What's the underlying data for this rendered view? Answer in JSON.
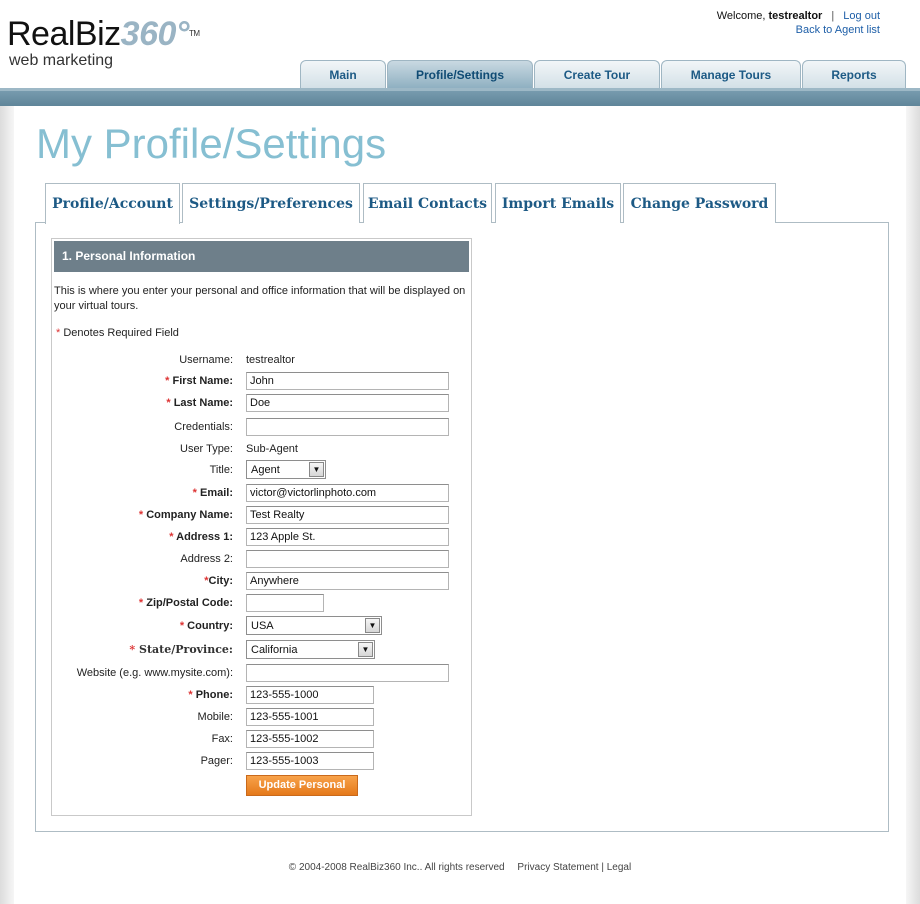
{
  "brand": {
    "name_part1": "RealBiz",
    "name_part2": "360",
    "degree": "°",
    "tm": "TM",
    "tagline": "web marketing"
  },
  "header": {
    "welcome_text": "Welcome,",
    "username": "testrealtor",
    "separator": "|",
    "logout": "Log out",
    "back_link": "Back to Agent list"
  },
  "nav": {
    "tabs": [
      "Main",
      "Profile/Settings",
      "Create Tour",
      "Manage Tours",
      "Reports"
    ],
    "active": "Profile/Settings"
  },
  "page_title": "My Profile/Settings",
  "subtabs": {
    "items": [
      "Profile/Account",
      "Settings/Preferences",
      "Email Contacts",
      "Import Emails",
      "Change Password"
    ],
    "active": "Profile/Account"
  },
  "section": {
    "title": "1. Personal Information",
    "intro": "This is where you enter your personal and office information that will be displayed on your virtual tours.",
    "required_note": "Denotes Required Field",
    "star": "*"
  },
  "form": {
    "username": {
      "label": "Username:",
      "value": "testrealtor"
    },
    "first_name": {
      "label": "First Name:",
      "value": "John"
    },
    "last_name": {
      "label": "Last Name:",
      "value": "Doe"
    },
    "credentials": {
      "label": "Credentials:",
      "value": ""
    },
    "user_type": {
      "label": "User Type:",
      "value": "Sub-Agent"
    },
    "title": {
      "label": "Title:",
      "value": "Agent"
    },
    "email": {
      "label": "Email:",
      "value": "victor@victorlinphoto.com"
    },
    "company": {
      "label": "Company Name:",
      "value": "Test Realty"
    },
    "address1": {
      "label": "Address 1:",
      "value": "123 Apple St."
    },
    "address2": {
      "label": "Address 2:",
      "value": ""
    },
    "city": {
      "label": "City:",
      "value": "Anywhere"
    },
    "zip": {
      "label": "Zip/Postal Code:",
      "value": ""
    },
    "country": {
      "label": "Country:",
      "value": "USA"
    },
    "state": {
      "label": "State/Province:",
      "value": "California"
    },
    "website": {
      "label": "Website (e.g. www.mysite.com):",
      "value": ""
    },
    "phone": {
      "label": "Phone:",
      "value": "123-555-1000"
    },
    "mobile": {
      "label": "Mobile:",
      "value": "123-555-1001"
    },
    "fax": {
      "label": "Fax:",
      "value": "123-555-1002"
    },
    "pager": {
      "label": "Pager:",
      "value": "123-555-1003"
    },
    "submit": "Update Personal"
  },
  "footer": {
    "copyright": "© 2004-2008 RealBiz360 Inc.. All rights reserved",
    "privacy": "Privacy Statement",
    "sep": "|",
    "legal": "Legal"
  },
  "colors": {
    "title": "#86bfd2",
    "nav_bar": "#6f93a6",
    "section_header": "#6e7f8a",
    "button": "#ef8a2c",
    "link": "#1e5fa8",
    "required": "#d33333"
  }
}
